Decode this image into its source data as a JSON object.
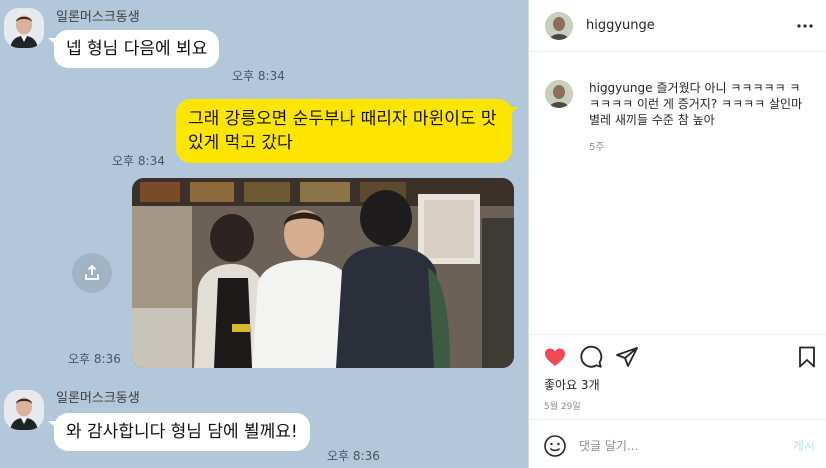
{
  "chat": {
    "sender_name": "일론머스크동생",
    "messages": [
      {
        "text": "넵 형님 다음에 뵈요",
        "time": "오후 8:34"
      },
      {
        "text": "그래 강릉오면 순두부나 때리자 마윈이도 맛있게 먹고 갔다",
        "time": "오후 8:34"
      },
      {
        "time": "오후 8:36"
      },
      {
        "text": "와 감사합니다 형님 담에 뵐께요!",
        "time": "오후 8:36"
      }
    ],
    "share_icon": "share-icon"
  },
  "ig": {
    "username": "higgyunge",
    "caption_user": "higgyunge",
    "caption": "즐거웠다 아니 ㅋㅋㅋㅋㅋ ㅋㅋㅋㅋㅋ 이런 게 증거지? ㅋㅋㅋㅋ 살인마 별레 새끼들 수준 참 높아",
    "caption_age": "5주",
    "likes": "좋아요 3개",
    "date": "5월 29일",
    "comment_placeholder": "댓글 달기...",
    "post_label": "게시",
    "colors": {
      "heart": "#ed4956",
      "post_disabled": "#b2dffc"
    },
    "icons": [
      "more-icon",
      "heart-icon",
      "comment-icon",
      "share-icon",
      "bookmark-icon",
      "emoji-icon"
    ]
  }
}
